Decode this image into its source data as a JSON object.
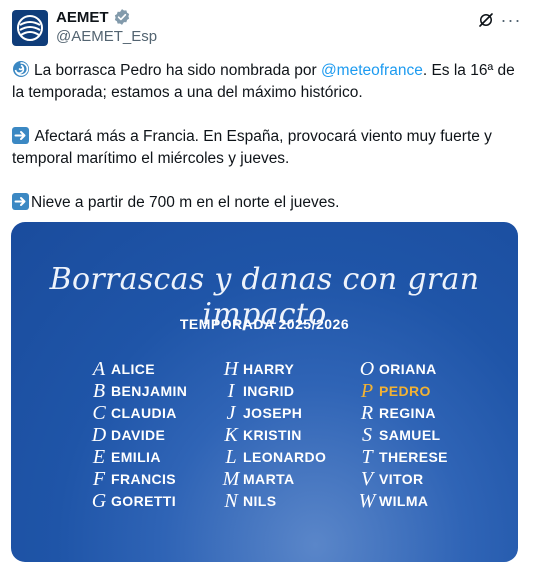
{
  "account": {
    "name": "AEMET",
    "handle": "@AEMET_Esp"
  },
  "icons": {
    "verified": "verified-badge-icon",
    "grok": "grok-icon",
    "more": "more-options-icon"
  },
  "tweet": {
    "p1_before": "La borrasca Pedro ha sido nombrada por ",
    "p1_mention": "@meteofrance",
    "p1_after": ". Es la 16ª de la temporada; estamos a una del máximo histórico.",
    "p2": "Afectará más a Francia. En España, provocará viento muy fuerte y temporal marítimo el miércoles y jueves.",
    "p3": "Nieve a partir de 700 m en el norte el jueves."
  },
  "card": {
    "title": "Borrascas y danas con gran impacto",
    "subtitle": "TEMPORADA 2025/2026",
    "highlight_color": "#f2b233",
    "columns": [
      [
        {
          "letter": "A",
          "name": "ALICE"
        },
        {
          "letter": "B",
          "name": "BENJAMIN"
        },
        {
          "letter": "C",
          "name": "CLAUDIA"
        },
        {
          "letter": "D",
          "name": "DAVIDE"
        },
        {
          "letter": "E",
          "name": "EMILIA"
        },
        {
          "letter": "F",
          "name": "FRANCIS"
        },
        {
          "letter": "G",
          "name": "GORETTI"
        }
      ],
      [
        {
          "letter": "H",
          "name": "HARRY"
        },
        {
          "letter": "I",
          "name": "INGRID"
        },
        {
          "letter": "J",
          "name": "JOSEPH"
        },
        {
          "letter": "K",
          "name": "KRISTIN"
        },
        {
          "letter": "L",
          "name": "LEONARDO"
        },
        {
          "letter": "M",
          "name": "MARTA"
        },
        {
          "letter": "N",
          "name": "NILS"
        }
      ],
      [
        {
          "letter": "O",
          "name": "ORIANA"
        },
        {
          "letter": "P",
          "name": "PEDRO",
          "highlight": true
        },
        {
          "letter": "R",
          "name": "REGINA"
        },
        {
          "letter": "S",
          "name": "SAMUEL"
        },
        {
          "letter": "T",
          "name": "THERESE"
        },
        {
          "letter": "V",
          "name": "VITOR"
        },
        {
          "letter": "W",
          "name": "WILMA"
        }
      ]
    ]
  }
}
